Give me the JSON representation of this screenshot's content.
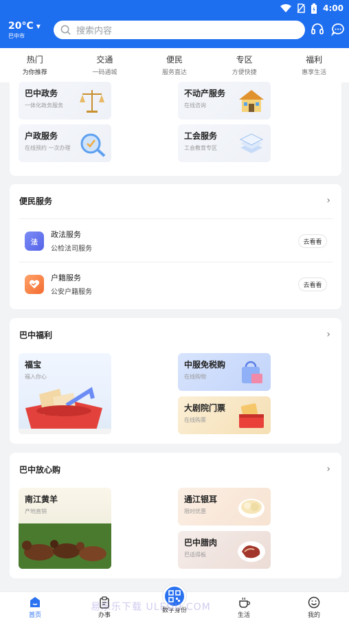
{
  "status": {
    "time": "4:00"
  },
  "weather": {
    "temp": "20°C",
    "city": "巴中市"
  },
  "search": {
    "placeholder": "搜索内容"
  },
  "tabs": [
    {
      "label": "热门",
      "sub": "为你推荐"
    },
    {
      "label": "交通",
      "sub": "一码通城"
    },
    {
      "label": "便民",
      "sub": "服务直达"
    },
    {
      "label": "专区",
      "sub": "方便快捷"
    },
    {
      "label": "福利",
      "sub": "惠享生活"
    }
  ],
  "services": [
    {
      "title": "巴中政务",
      "sub": "一体化政务服务"
    },
    {
      "title": "不动产服务",
      "sub": "在线咨询"
    },
    {
      "title": "户政服务",
      "sub": "在线预约 一次办理"
    },
    {
      "title": "工会服务",
      "sub": "工会教育专区"
    }
  ],
  "convenience": {
    "title": "便民服务",
    "items": [
      {
        "icon_text": "法",
        "title": "政法服务",
        "sub": "公检法司服务",
        "button": "去看看"
      },
      {
        "title": "户籍服务",
        "sub": "公安户籍服务",
        "button": "去看看"
      }
    ]
  },
  "welfare": {
    "title": "巴中福利",
    "big": {
      "title": "福宝",
      "sub": "福入你心"
    },
    "items": [
      {
        "title": "中服免税购",
        "sub": "在线购物"
      },
      {
        "title": "大剧院门票",
        "sub": "在线购票"
      }
    ]
  },
  "shopping": {
    "title": "巴中放心购",
    "big": {
      "title": "南江黄羊",
      "sub": "产地直销"
    },
    "items": [
      {
        "title": "通江银耳",
        "sub": "限时优惠"
      },
      {
        "title": "巴中腊肉",
        "sub": "巴适得板"
      }
    ]
  },
  "nav": [
    {
      "label": "首页"
    },
    {
      "label": "办事"
    },
    {
      "label": "数字身份"
    },
    {
      "label": "生活"
    },
    {
      "label": "我的"
    }
  ],
  "watermark": "易乐乐下载 ULEDU.COM",
  "colors": {
    "primary": "#1e6ef0",
    "accent": "#2a72f0"
  }
}
